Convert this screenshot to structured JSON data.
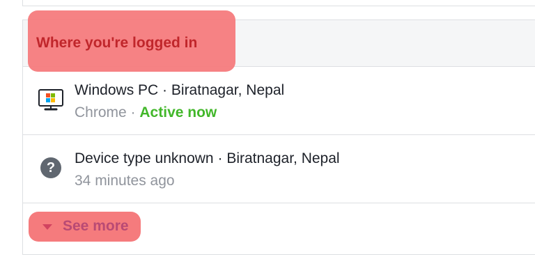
{
  "panel": {
    "title": "Where you're logged in"
  },
  "sessions": [
    {
      "device": "Windows PC",
      "separator": "·",
      "location": "Biratnagar, Nepal",
      "browser": "Chrome",
      "status": "Active now",
      "icon": "windows-pc-icon"
    },
    {
      "device": "Device type unknown",
      "separator": "·",
      "location": "Biratnagar, Nepal",
      "time": "34 minutes ago",
      "icon": "question-icon"
    }
  ],
  "actions": {
    "see_more": "See more"
  },
  "colors": {
    "highlight": "#f57b7d",
    "title": "#c0262b",
    "active": "#42b72a",
    "meta": "#90949c",
    "border": "#dddfe2"
  }
}
